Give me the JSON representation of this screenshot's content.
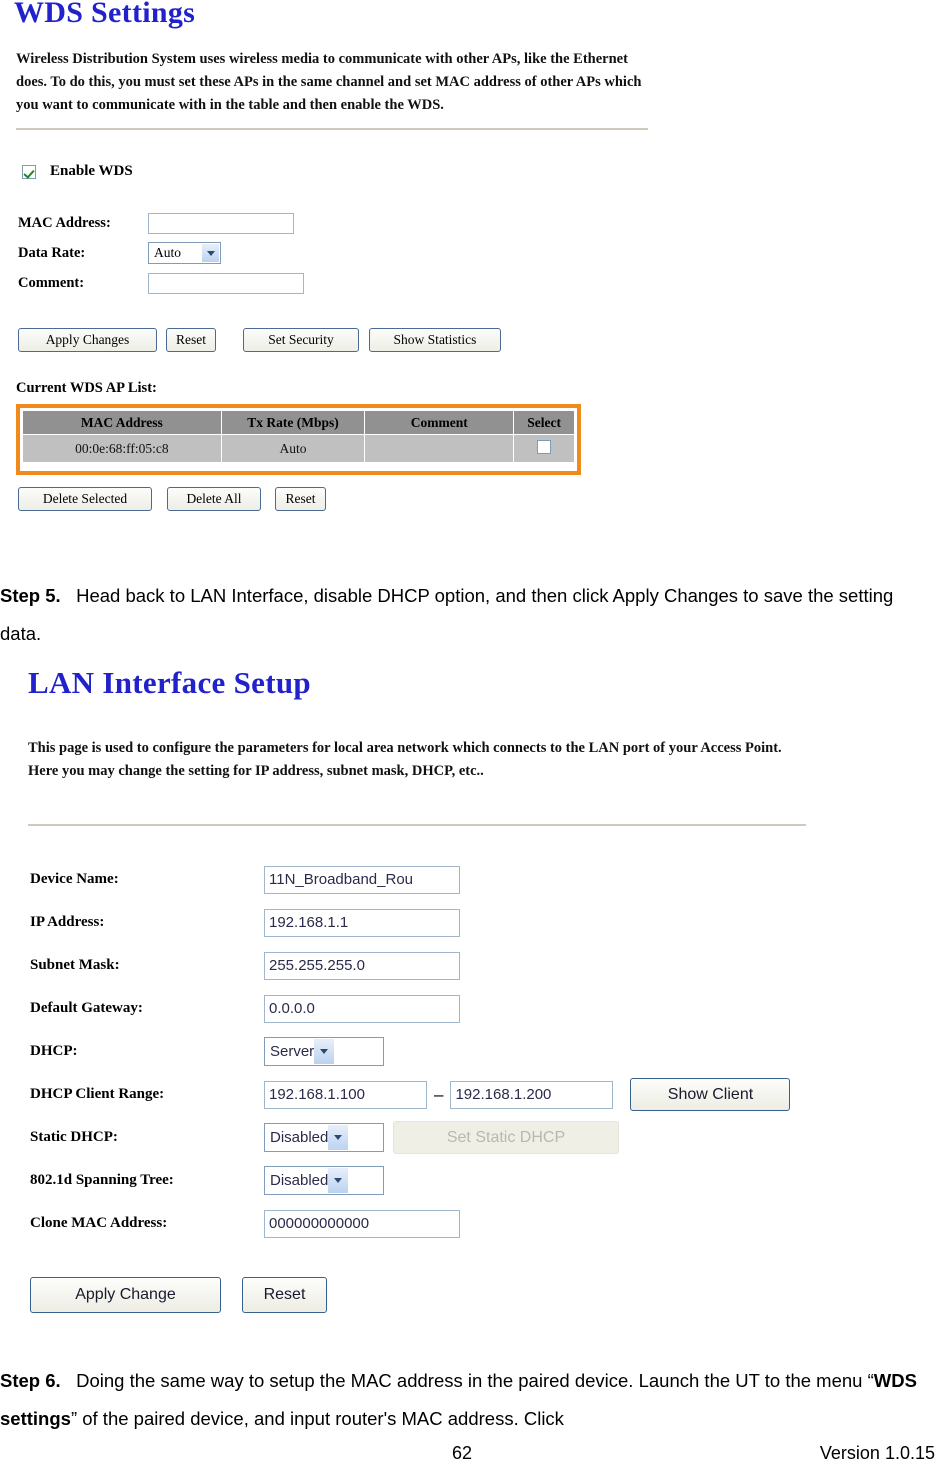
{
  "page": {
    "number": "62",
    "version": "Version 1.0.15"
  },
  "wds_screenshot": {
    "title": "WDS Settings",
    "description": "Wireless Distribution System uses wireless media to communicate with other APs, like the Ethernet does. To do this, you must set these APs in the same channel and set MAC address of other APs which you want to communicate with in the table and then enable the WDS.",
    "enable_wds_label": "Enable WDS",
    "enable_wds_checked": true,
    "fields": {
      "mac_address_label": "MAC Address:",
      "mac_address_value": "",
      "data_rate_label": "Data Rate:",
      "data_rate_value": "Auto",
      "comment_label": "Comment:",
      "comment_value": ""
    },
    "buttons": {
      "apply_changes": "Apply Changes",
      "reset": "Reset",
      "set_security": "Set Security",
      "show_statistics": "Show Statistics"
    },
    "list_caption": "Current WDS AP List:",
    "table": {
      "headers": [
        "MAC Address",
        "Tx Rate (Mbps)",
        "Comment",
        "Select"
      ],
      "rows": [
        {
          "mac_address": "00:0e:68:ff:05:c8",
          "tx_rate": "Auto",
          "comment": "",
          "selected": false
        }
      ]
    },
    "table_highlight_color": "#f08a1c",
    "list_buttons": {
      "delete_selected": "Delete Selected",
      "delete_all": "Delete All",
      "reset": "Reset"
    }
  },
  "step5": {
    "label": "Step 5.",
    "text": "Head back to LAN Interface, disable DHCP option, and then click Apply Changes to save the setting data."
  },
  "lan_screenshot": {
    "title": "LAN Interface Setup",
    "description": "This page is used to configure the parameters for local area network which connects to the LAN port of your Access Point. Here you may change the setting for IP address, subnet mask, DHCP, etc..",
    "fields": {
      "device_name_label": "Device Name:",
      "device_name_value": "11N_Broadband_Rou",
      "ip_address_label": "IP Address:",
      "ip_address_value": "192.168.1.1",
      "subnet_mask_label": "Subnet Mask:",
      "subnet_mask_value": "255.255.255.0",
      "default_gateway_label": "Default Gateway:",
      "default_gateway_value": "0.0.0.0",
      "dhcp_label": "DHCP:",
      "dhcp_value": "Server",
      "dhcp_client_range_label": "DHCP Client Range:",
      "dhcp_range_start": "192.168.1.100",
      "dhcp_range_separator": "–",
      "dhcp_range_end": "192.168.1.200",
      "show_client_button": "Show Client",
      "static_dhcp_label": "Static DHCP:",
      "static_dhcp_value": "Disabled",
      "set_static_dhcp_button": "Set Static DHCP",
      "spanning_tree_label": "802.1d Spanning Tree:",
      "spanning_tree_value": "Disabled",
      "clone_mac_label": "Clone MAC Address:",
      "clone_mac_value": "000000000000"
    },
    "buttons": {
      "apply_change": "Apply Change",
      "reset": "Reset"
    }
  },
  "step6": {
    "label": "Step 6.",
    "text_part1": "Doing the same way to setup the MAC address in the paired device. Launch the UT to the menu “",
    "bold_term": "WDS settings",
    "text_part2": "” of the paired device, and input router's MAC address. Click"
  }
}
